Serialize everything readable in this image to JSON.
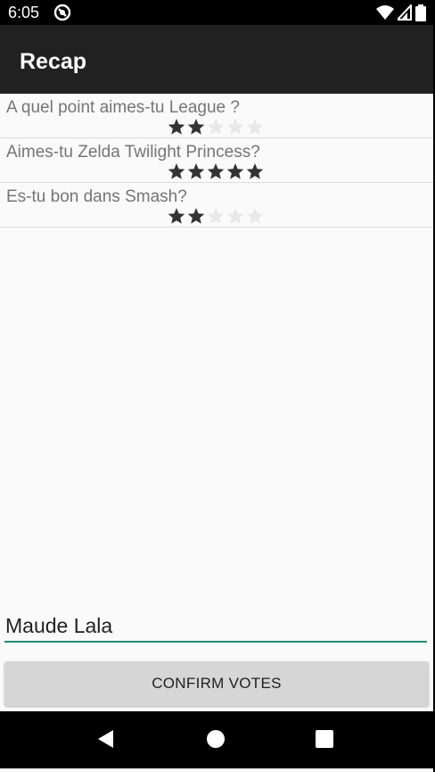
{
  "status_bar": {
    "time": "6:05",
    "icons": [
      "app-notification-icon",
      "wifi-icon",
      "cell-signal-icon",
      "battery-icon"
    ]
  },
  "app_bar": {
    "title": "Recap"
  },
  "votes": [
    {
      "question": "A quel point aimes-tu League ?",
      "rating": 2,
      "max_rating": 5
    },
    {
      "question": "Aimes-tu Zelda Twilight Princess?",
      "rating": 5,
      "max_rating": 5
    },
    {
      "question": "Es-tu bon dans Smash?",
      "rating": 2,
      "max_rating": 5
    }
  ],
  "name_input": {
    "value": "Maude Lala"
  },
  "confirm_button": {
    "label": "CONFIRM VOTES"
  },
  "nav_bar": {
    "items": [
      "back-icon",
      "home-icon",
      "recents-icon"
    ]
  },
  "colors": {
    "app_bar": "#212121",
    "accent": "#26897b",
    "star_filled": "#333333",
    "star_empty": "#e8e8e8",
    "question_text": "#757575"
  }
}
